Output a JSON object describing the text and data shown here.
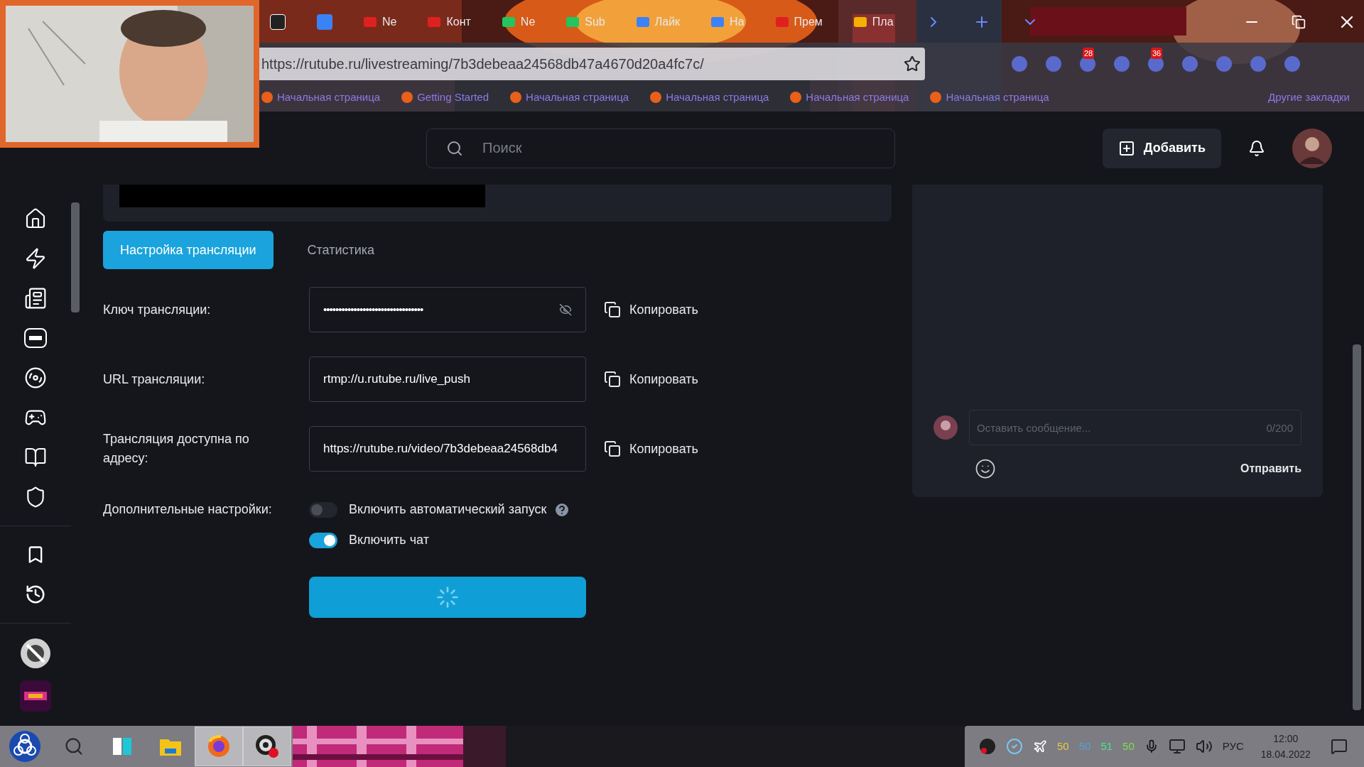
{
  "browser": {
    "tabs": [
      {
        "label": "Ne",
        "color": "#e02020"
      },
      {
        "label": "Конт",
        "color": "#e02020"
      },
      {
        "label": "Ne",
        "color": "#22c55e"
      },
      {
        "label": "Sub",
        "color": "#22c55e"
      },
      {
        "label": "Лайк",
        "color": "#3b82f6"
      },
      {
        "label": "На",
        "color": "#3b82f6"
      },
      {
        "label": "Прем",
        "color": "#e02020"
      },
      {
        "label": "Пла",
        "color": "#f5b000"
      }
    ],
    "address": "https://rutube.ru/livestreaming/7b3debeaa24568db47a4670d20a4fc7c/",
    "extension_badges": [
      "28",
      "36"
    ],
    "bookmarks": [
      "Начальная страница",
      "Getting Started",
      "Начальная страница",
      "Начальная страница",
      "Начальная страница",
      "Начальная страница"
    ],
    "other_bookmarks": "Другие закладки"
  },
  "header": {
    "search_placeholder": "Поиск",
    "add_button": "Добавить"
  },
  "tabs": [
    {
      "label": "Настройка трансляции",
      "selected": true
    },
    {
      "label": "Статистика",
      "selected": false
    }
  ],
  "fields": [
    {
      "label": "Ключ трансляции:",
      "kind": "secret",
      "value": "•••••••••••••••••••••••••••••••••",
      "copy": "Копировать"
    },
    {
      "label": "URL трансляции:",
      "kind": "text",
      "value": "rtmp://u.rutube.ru/live_push",
      "copy": "Копировать"
    },
    {
      "label": "Трансляция доступна по адресу:",
      "kind": "text",
      "value": "https://rutube.ru/video/7b3debeaa24568db4",
      "copy": "Копировать"
    }
  ],
  "extra": {
    "label": "Дополнительные настройки:",
    "toggles": [
      {
        "label": "Включить автоматический запуск",
        "on": false,
        "help": true
      },
      {
        "label": "Включить чат",
        "on": true,
        "help": false
      }
    ]
  },
  "chat": {
    "placeholder": "Оставить сообщение...",
    "counter": "0/200",
    "send": "Отправить"
  },
  "taskbar": {
    "apps": [
      {
        "kind": "search",
        "active": false
      },
      {
        "kind": "widgets",
        "active": false
      },
      {
        "kind": "folder",
        "active": false
      },
      {
        "kind": "browser",
        "active": true
      },
      {
        "kind": "recorder",
        "active": true
      }
    ],
    "tray_numbers": [
      {
        "text": "50",
        "color": "#e6c84a"
      },
      {
        "text": "50",
        "color": "#5a9fd6"
      },
      {
        "text": "51",
        "color": "#4ee38a"
      },
      {
        "text": "50",
        "color": "#7be04a"
      }
    ],
    "language": "РУС",
    "time": "12:00",
    "date": "18.04.2022"
  }
}
